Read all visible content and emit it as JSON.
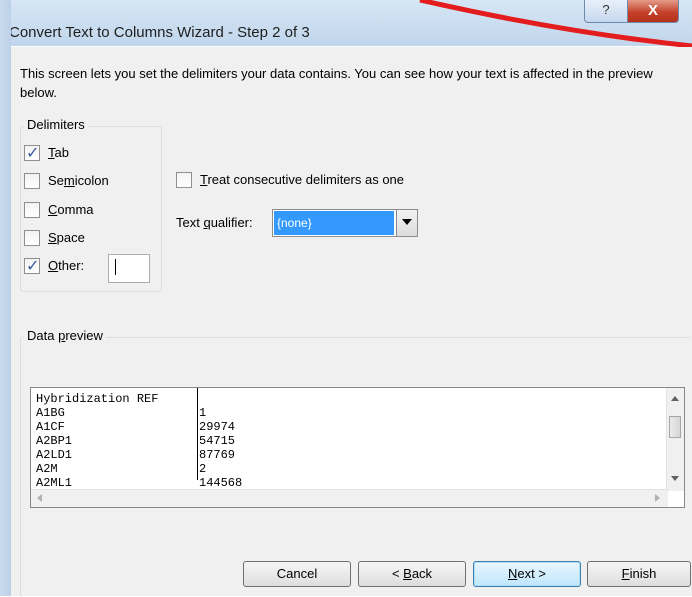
{
  "window": {
    "title": "Convert Text to Columns Wizard - Step 2 of 3",
    "help_glyph": "?",
    "close_glyph": "X",
    "annotation_color": "#e31d1d"
  },
  "instructions": "This screen lets you set the delimiters your data contains.  You can see how your text is affected in the preview below.",
  "delimiters": {
    "legend": "Delimiters",
    "items": [
      {
        "pre": "",
        "key": "T",
        "post": "ab",
        "checked": true
      },
      {
        "pre": "Se",
        "key": "m",
        "post": "icolon",
        "checked": false
      },
      {
        "pre": "",
        "key": "C",
        "post": "omma",
        "checked": false
      },
      {
        "pre": "",
        "key": "S",
        "post": "pace",
        "checked": false
      },
      {
        "pre": "",
        "key": "O",
        "post": "ther:",
        "checked": true
      }
    ],
    "other_value": ""
  },
  "options": {
    "consecutive": {
      "pre": "",
      "key": "T",
      "post": "reat consecutive delimiters as one",
      "checked": false
    },
    "qualifier": {
      "pre": "Text ",
      "key": "q",
      "post": "ualifier:",
      "value": "{none}"
    }
  },
  "preview": {
    "legend_pre": "Data ",
    "legend_key": "p",
    "legend_post": "review",
    "rows": [
      [
        "Hybridization REF",
        ""
      ],
      [
        "A1BG",
        "1"
      ],
      [
        "A1CF",
        "29974"
      ],
      [
        "A2BP1",
        "54715"
      ],
      [
        "A2LD1",
        "87769"
      ],
      [
        "A2M",
        "2"
      ],
      [
        "A2ML1",
        "144568"
      ]
    ]
  },
  "buttons": {
    "cancel": "Cancel",
    "back_pre": "< ",
    "back_key": "B",
    "back_post": "ack",
    "next_key": "N",
    "next_post": "ext >",
    "finish_key": "F",
    "finish_post": "inish"
  }
}
